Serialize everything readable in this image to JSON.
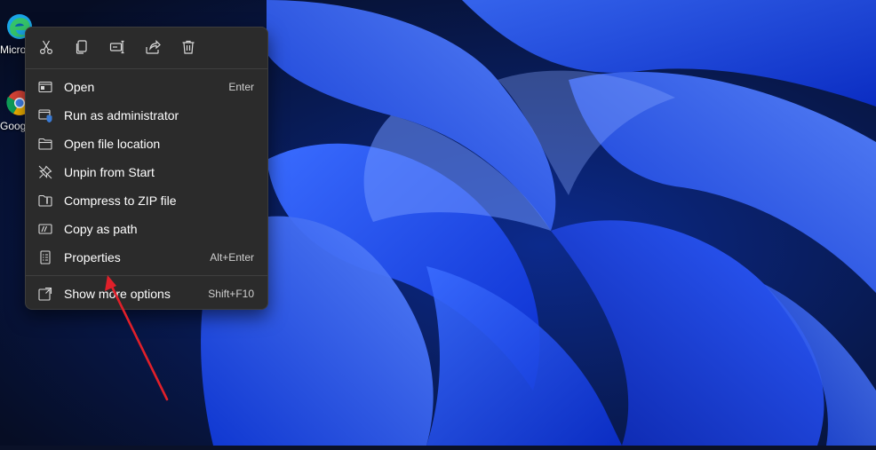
{
  "desktop": {
    "icons": [
      {
        "name": "edge-icon",
        "label": "Microsoft Edge"
      },
      {
        "name": "chrome-icon",
        "label": "Google Chrome"
      }
    ]
  },
  "context_menu": {
    "quick_actions": [
      {
        "name": "cut-icon",
        "tooltip": "Cut"
      },
      {
        "name": "copy-icon",
        "tooltip": "Copy"
      },
      {
        "name": "rename-icon",
        "tooltip": "Rename"
      },
      {
        "name": "share-icon",
        "tooltip": "Share"
      },
      {
        "name": "delete-icon",
        "tooltip": "Delete"
      }
    ],
    "items": [
      {
        "label": "Open",
        "shortcut": "Enter",
        "icon": "open-icon"
      },
      {
        "label": "Run as administrator",
        "shortcut": "",
        "icon": "run-as-admin-icon"
      },
      {
        "label": "Open file location",
        "shortcut": "",
        "icon": "folder-icon"
      },
      {
        "label": "Unpin from Start",
        "shortcut": "",
        "icon": "unpin-icon"
      },
      {
        "label": "Compress to ZIP file",
        "shortcut": "",
        "icon": "zip-folder-icon"
      },
      {
        "label": "Copy as path",
        "shortcut": "",
        "icon": "copy-path-icon"
      },
      {
        "label": "Properties",
        "shortcut": "Alt+Enter",
        "icon": "properties-icon"
      },
      {
        "label": "Show more options",
        "shortcut": "Shift+F10",
        "icon": "more-options-icon"
      }
    ]
  },
  "colors": {
    "menu_bg": "#2b2b2b",
    "annotation_arrow": "#e0202a",
    "accent": "#1f5cff"
  }
}
